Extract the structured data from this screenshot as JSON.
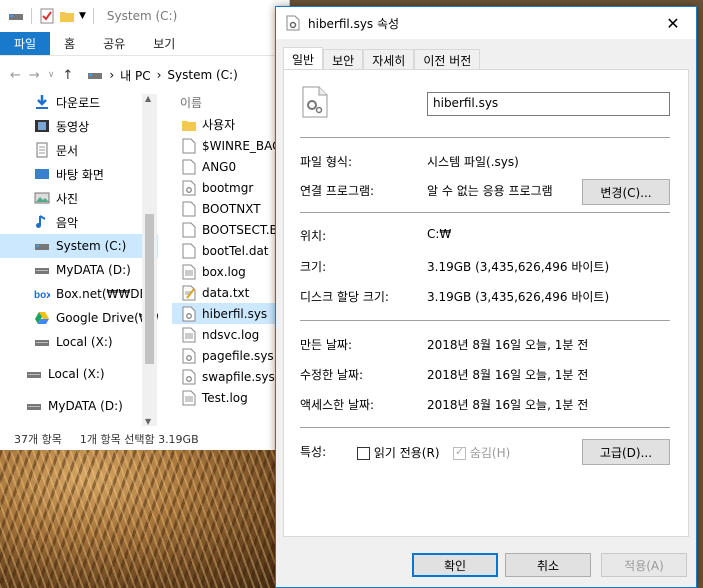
{
  "explorer": {
    "title": "System (C:)",
    "ribbon_tabs": [
      "파일",
      "홈",
      "공유",
      "보기"
    ],
    "address": {
      "root": "내 PC",
      "sep": "›",
      "current": "System (C:)"
    },
    "nav_items": [
      {
        "label": "다운로드",
        "icon": "download-icon"
      },
      {
        "label": "동영상",
        "icon": "video-icon"
      },
      {
        "label": "문서",
        "icon": "document-icon"
      },
      {
        "label": "바탕 화면",
        "icon": "desktop-icon"
      },
      {
        "label": "사진",
        "icon": "picture-icon"
      },
      {
        "label": "음악",
        "icon": "music-icon"
      },
      {
        "label": "System (C:)",
        "icon": "drive-icon",
        "selected": true
      },
      {
        "label": "MyDATA (D:)",
        "icon": "drive-icon"
      },
      {
        "label": "Box.net(₩₩DESI",
        "icon": "box-icon"
      },
      {
        "label": "Google Drive(₩₩",
        "icon": "google-drive-icon"
      },
      {
        "label": "Local (X:)",
        "icon": "drive-icon"
      },
      {
        "label": "Local (X:)",
        "icon": "drive-icon"
      },
      {
        "label": "MyDATA (D:)",
        "icon": "drive-icon"
      }
    ],
    "column_header": "이름",
    "files": [
      {
        "name": "사용자",
        "icon": "folder-icon"
      },
      {
        "name": "$WINRE_BACK",
        "icon": "file-icon"
      },
      {
        "name": "ANG0",
        "icon": "file-icon"
      },
      {
        "name": "bootmgr",
        "icon": "system-file-icon"
      },
      {
        "name": "BOOTNXT",
        "icon": "file-icon"
      },
      {
        "name": "BOOTSECT.BA",
        "icon": "file-icon"
      },
      {
        "name": "bootTel.dat",
        "icon": "file-icon"
      },
      {
        "name": "box.log",
        "icon": "text-file-icon"
      },
      {
        "name": "data.txt",
        "icon": "text-file-icon"
      },
      {
        "name": "hiberfil.sys",
        "icon": "system-file-icon",
        "selected": true
      },
      {
        "name": "ndsvc.log",
        "icon": "text-file-icon"
      },
      {
        "name": "pagefile.sys",
        "icon": "system-file-icon"
      },
      {
        "name": "swapfile.sys",
        "icon": "system-file-icon"
      },
      {
        "name": "Test.log",
        "icon": "text-file-icon"
      }
    ],
    "status": {
      "count": "37개 항목",
      "selection": "1개 항목 선택함 3.19GB"
    }
  },
  "props": {
    "title": "hiberfil.sys 속성",
    "tabs": [
      "일반",
      "보안",
      "자세히",
      "이전 버전"
    ],
    "file_name": "hiberfil.sys",
    "labels": {
      "type": "파일 형식:",
      "opens_with": "연결 프로그램:",
      "location": "위치:",
      "size": "크기:",
      "size_on_disk": "디스크 할당 크기:",
      "created": "만든 날짜:",
      "modified": "수정한 날짜:",
      "accessed": "액세스한 날짜:",
      "attributes": "특성:"
    },
    "values": {
      "type": "시스템 파일(.sys)",
      "opens_with": "알 수 없는 응용 프로그램",
      "location": "C:₩",
      "size": "3.19GB (3,435,626,496 바이트)",
      "size_on_disk": "3.19GB (3,435,626,496 바이트)",
      "created": "2018년 8월 16일 오늘, 1분 전",
      "modified": "2018년 8월 16일 오늘, 1분 전",
      "accessed": "2018년 8월 16일 오늘, 1분 전"
    },
    "buttons": {
      "change": "변경(C)...",
      "advanced": "고급(D)...",
      "ok": "확인",
      "cancel": "취소",
      "apply": "적용(A)"
    },
    "attributes": {
      "readonly": "읽기 전용(R)",
      "hidden": "숨김(H)",
      "readonly_checked": false,
      "hidden_checked": true
    },
    "close_glyph": "✕"
  }
}
